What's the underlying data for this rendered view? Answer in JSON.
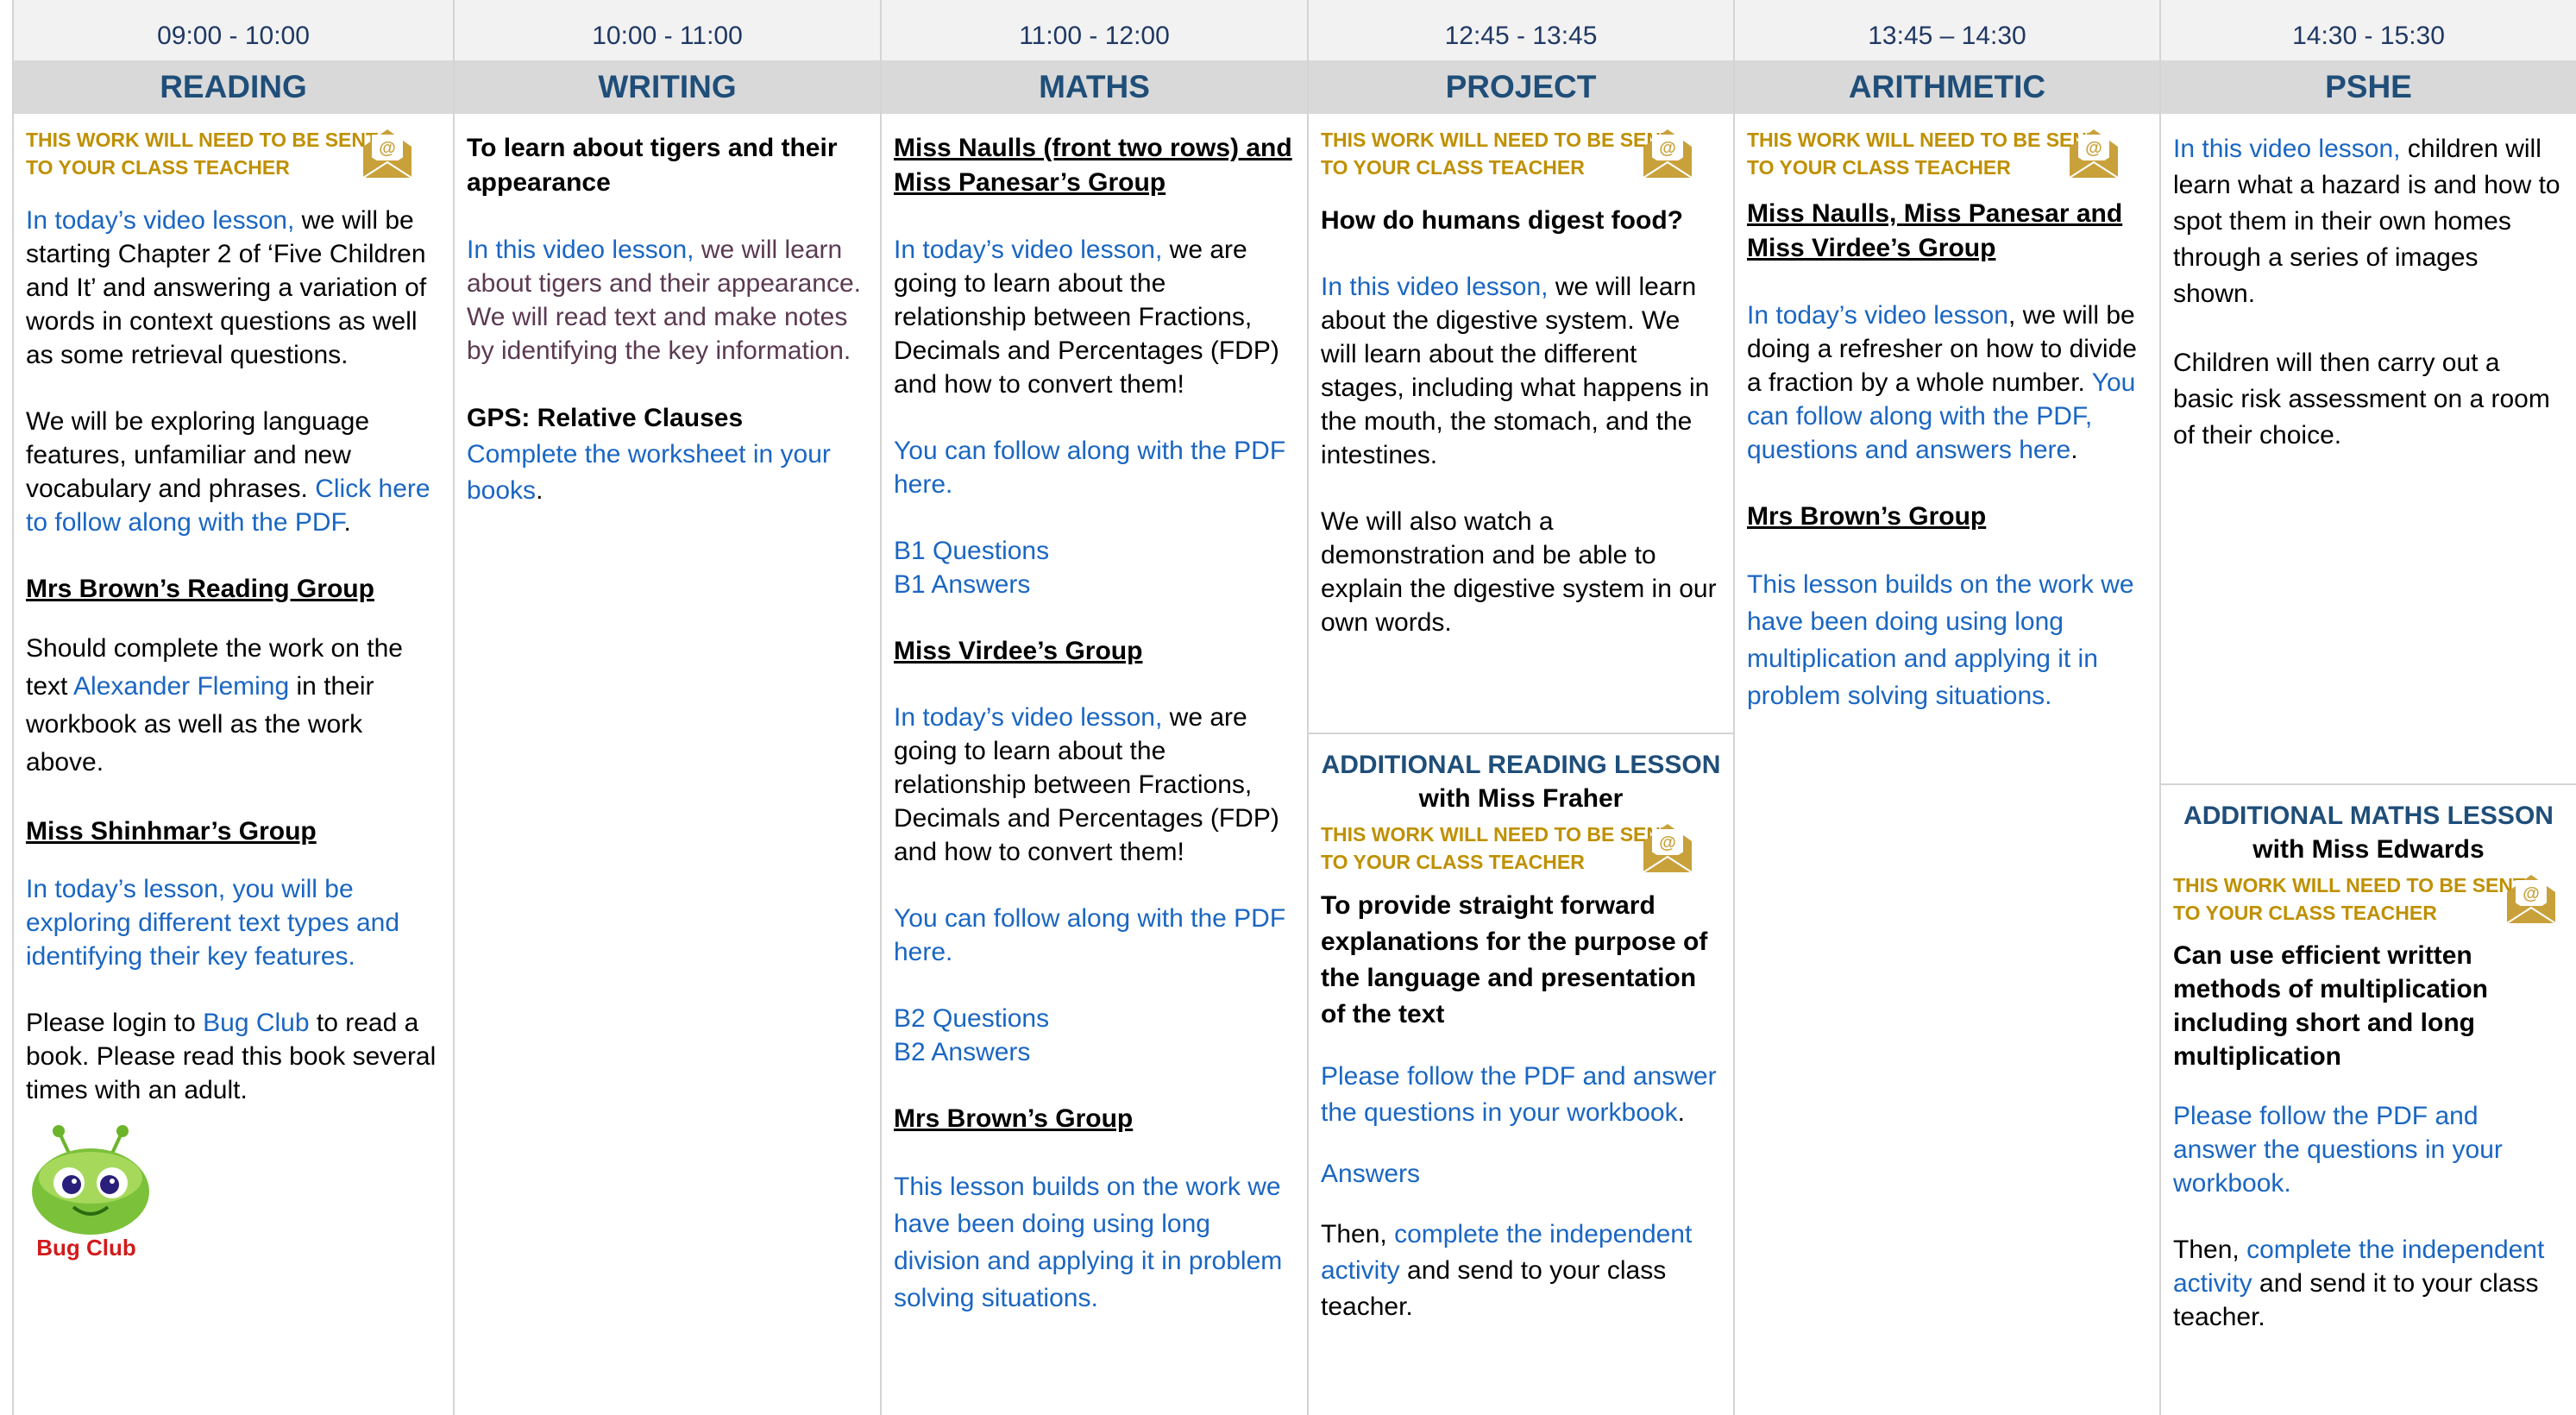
{
  "colors": {
    "header_blue": "#1f4e79",
    "time_blue": "#1f3864",
    "link_blue": "#1a66c2",
    "warn_gold": "#bf9000",
    "header_grey": "#d9d9d9",
    "time_grey": "#f2f2f2"
  },
  "warning": "THIS WORK WILL NEED TO BE SENT TO YOUR CLASS TEACHER",
  "columns": [
    {
      "time": "09:00 - 10:00",
      "subject": "READING"
    },
    {
      "time": "10:00 - 11:00",
      "subject": "WRITING"
    },
    {
      "time": "11:00 - 12:00",
      "subject": "MATHS"
    },
    {
      "time": "12:45 - 13:45",
      "subject": "PROJECT"
    },
    {
      "time": "13:45 – 14:30",
      "subject": "ARITHMETIC"
    },
    {
      "time": "14:30 - 15:30",
      "subject": "PSHE"
    }
  ],
  "reading": {
    "p1_link": "In today’s video lesson,",
    "p1_text": " we will be starting Chapter 2 of ‘Five Children and It’ and answering a variation of words in context questions as well as some retrieval questions.",
    "p2_text": "We will be exploring language features, unfamiliar and new vocabulary and phrases. ",
    "p2_link": "Click here to follow along with the PDF",
    "p2_end": ".",
    "group1": "Mrs Brown’s Reading Group",
    "g1_a": "Should complete the work on the text ",
    "g1_link": "Alexander Fleming",
    "g1_b": " in their workbook as well as the work above.",
    "group2": "Miss Shinhmar’s Group",
    "g2_link": "In today’s lesson, you will be exploring different text types and identifying their key features.",
    "login_a": "Please login to ",
    "login_link": "Bug Club",
    "login_b": " to read a book. Please read this book several times with an adult.",
    "logo_text": "Bug Club"
  },
  "writing": {
    "title": "To learn about tigers and their appearance",
    "p_link": "In this video lesson,",
    "p_text": " we will learn about tigers and their appearance. We will read text and make notes by identifying the key information.",
    "gps": "GPS: Relative Clauses",
    "gps_link": "Complete the worksheet in your books",
    "gps_end": "."
  },
  "maths": {
    "group1": "Miss Naulls (front two rows) and Miss Panesar’s Group",
    "p1_link": "In today’s video lesson,",
    "p1_text": " we are going to learn about the relationship between Fractions, Decimals and Percentages (FDP) and how to convert them!",
    "follow1": "You can follow along with the PDF here.",
    "b1q": "B1 Questions",
    "b1a": "B1 Answers",
    "group2": "Miss Virdee’s Group",
    "p2_link": "In today’s video lesson,",
    "p2_text": " we are going to learn about the relationship between Fractions, Decimals and Percentages (FDP) and how to convert them!",
    "follow2": "You can follow along with the PDF here.",
    "b2q": "B2 Questions",
    "b2a": "B2 Answers",
    "group3": "Mrs Brown’s Group",
    "p3_link": "This lesson builds on the work we have been doing using long division and applying it in problem solving situations."
  },
  "project": {
    "question": "How do humans digest food?",
    "p1_link": "In this video lesson,",
    "p1_text": " we will learn about the digestive system. We will learn about the different stages, including what happens in the mouth, the stomach, and the intestines.",
    "p2": "We will also watch a demonstration and be able to explain the digestive system in our own words.",
    "add_title": "ADDITIONAL READING LESSON",
    "add_sub": "with Miss Fraher",
    "objective": "To provide straight forward explanations for the purpose of the language and presentation of the text",
    "follow_link": "Please follow the PDF and answer the questions in your workbook",
    "follow_end": ".",
    "answers": "Answers",
    "then_a": "Then, ",
    "then_link": "complete the independent activity",
    "then_b": " and send to your class teacher."
  },
  "arithmetic": {
    "group1": "Miss Naulls, Miss Panesar and Miss Virdee’s Group",
    "p1_link": "In today’s video lesson",
    "p1_text": ", we will be doing a refresher on how to divide a fraction by a whole number. ",
    "p1_link2": "You can follow along with the PDF, questions and answers here",
    "p1_end": ".",
    "group2": "Mrs Brown’s Group",
    "p2_link": "This lesson builds on the work we have been doing using long multiplication and applying it in problem solving situations."
  },
  "pshe": {
    "p1_link": "In this video lesson,",
    "p1_text": " children will learn what a hazard is and how to spot them in their own homes through a series of images shown.",
    "p2": "Children will then carry out a basic risk assessment on a room of their choice.",
    "add_title": "ADDITIONAL MATHS LESSON",
    "add_sub": "with Miss Edwards",
    "objective": "Can use efficient written methods of multiplication including short and long multiplication",
    "follow_link": "Please follow the PDF and answer the questions in your workbook.",
    "then_a": "Then, ",
    "then_link": "complete the independent activity",
    "then_b": " and send it to your class teacher."
  }
}
